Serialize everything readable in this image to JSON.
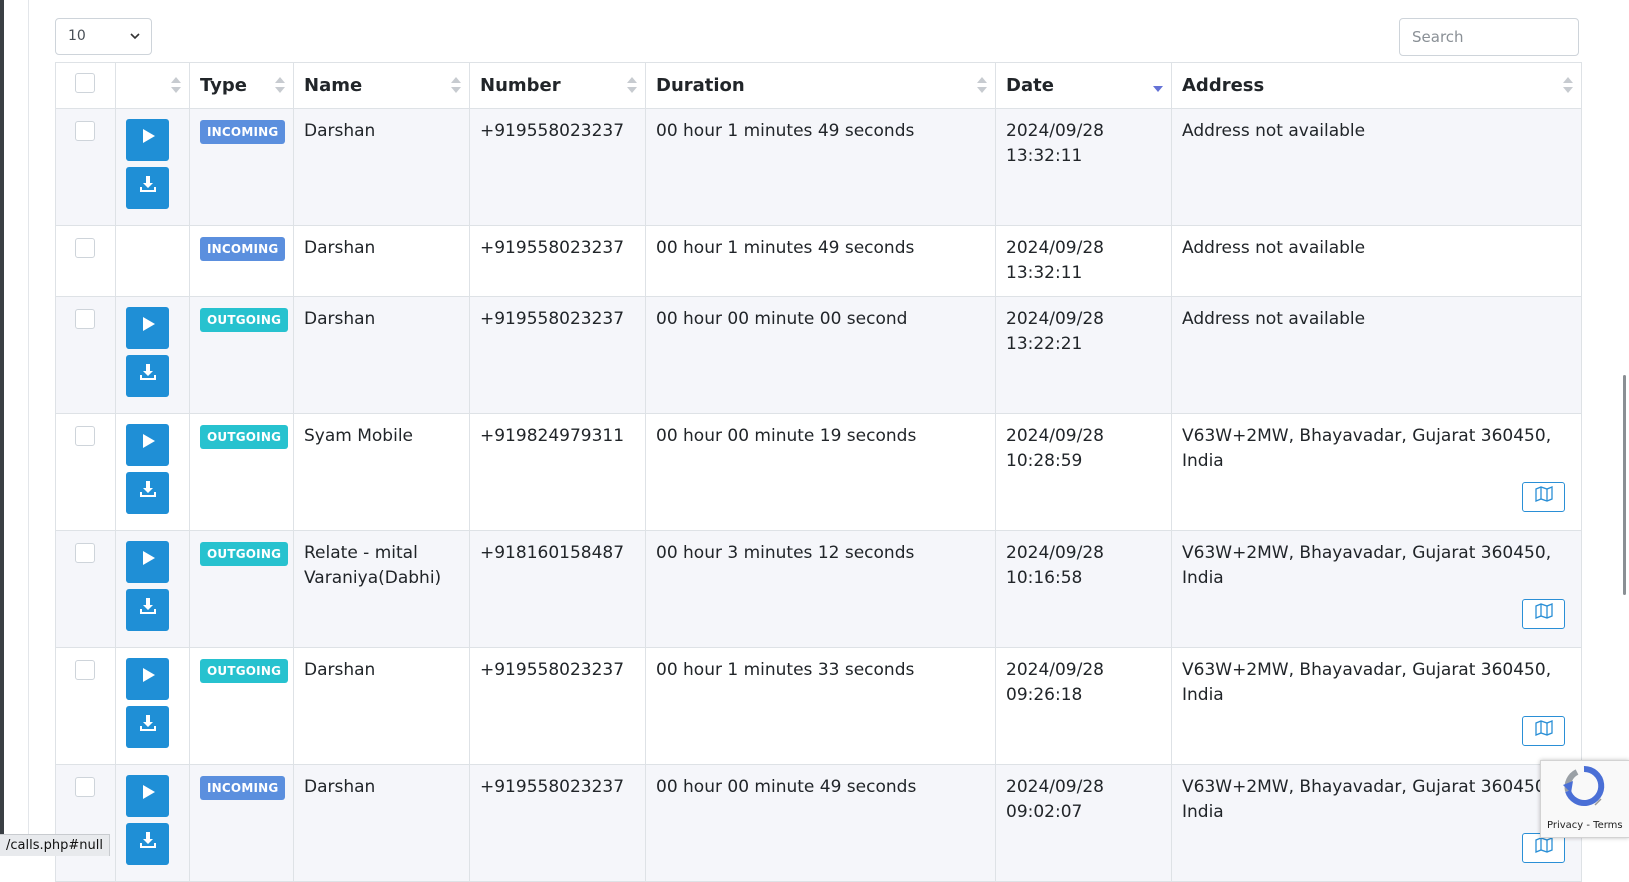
{
  "page_length": {
    "value": "10",
    "icon": "chevron-down-icon"
  },
  "search": {
    "placeholder": "Search"
  },
  "table": {
    "columns": [
      "",
      "",
      "Type",
      "Name",
      "Number",
      "Duration",
      "Date",
      "Address"
    ],
    "sorted_column": "Date",
    "rows": [
      {
        "type": "INCOMING",
        "name": "Darshan",
        "number": "+919558023237",
        "duration": "00 hour 1 minutes 49 seconds",
        "date": "2024/09/28",
        "time": "13:32:11",
        "address": "Address not available",
        "has_media": true,
        "has_map": false
      },
      {
        "type": "INCOMING",
        "name": "Darshan",
        "number": "+919558023237",
        "duration": "00 hour 1 minutes 49 seconds",
        "date": "2024/09/28",
        "time": "13:32:11",
        "address": "Address not available",
        "has_media": false,
        "has_map": false
      },
      {
        "type": "OUTGOING",
        "name": "Darshan",
        "number": "+919558023237",
        "duration": "00 hour 00 minute 00 second",
        "date": "2024/09/28",
        "time": "13:22:21",
        "address": "Address not available",
        "has_media": true,
        "has_map": false
      },
      {
        "type": "OUTGOING",
        "name": "Syam Mobile",
        "number": "+919824979311",
        "duration": "00 hour 00 minute 19 seconds",
        "date": "2024/09/28",
        "time": "10:28:59",
        "address": "V63W+2MW, Bhayavadar, Gujarat 360450, India",
        "has_media": true,
        "has_map": true
      },
      {
        "type": "OUTGOING",
        "name": "Relate - mital Varaniya(Dabhi)",
        "number": "+918160158487",
        "duration": "00 hour 3 minutes 12 seconds",
        "date": "2024/09/28",
        "time": "10:16:58",
        "address": "V63W+2MW, Bhayavadar, Gujarat 360450, India",
        "has_media": true,
        "has_map": true
      },
      {
        "type": "OUTGOING",
        "name": "Darshan",
        "number": "+919558023237",
        "duration": "00 hour 1 minutes 33 seconds",
        "date": "2024/09/28",
        "time": "09:26:18",
        "address": "V63W+2MW, Bhayavadar, Gujarat 360450, India",
        "has_media": true,
        "has_map": true
      },
      {
        "type": "INCOMING",
        "name": "Darshan",
        "number": "+919558023237",
        "duration": "00 hour 00 minute 49 seconds",
        "date": "2024/09/28",
        "time": "09:02:07",
        "address": "V63W+2MW, Bhayavadar, Gujarat 360450, India",
        "has_media": true,
        "has_map": true
      }
    ]
  },
  "colors": {
    "incoming_badge": "#5b8fde",
    "outgoing_badge": "#27c2cf",
    "action_button": "#1f8fd6",
    "sort_active": "#6472d6"
  },
  "status_url": "/calls.php#null",
  "recaptcha": {
    "links": "Privacy - Terms"
  }
}
